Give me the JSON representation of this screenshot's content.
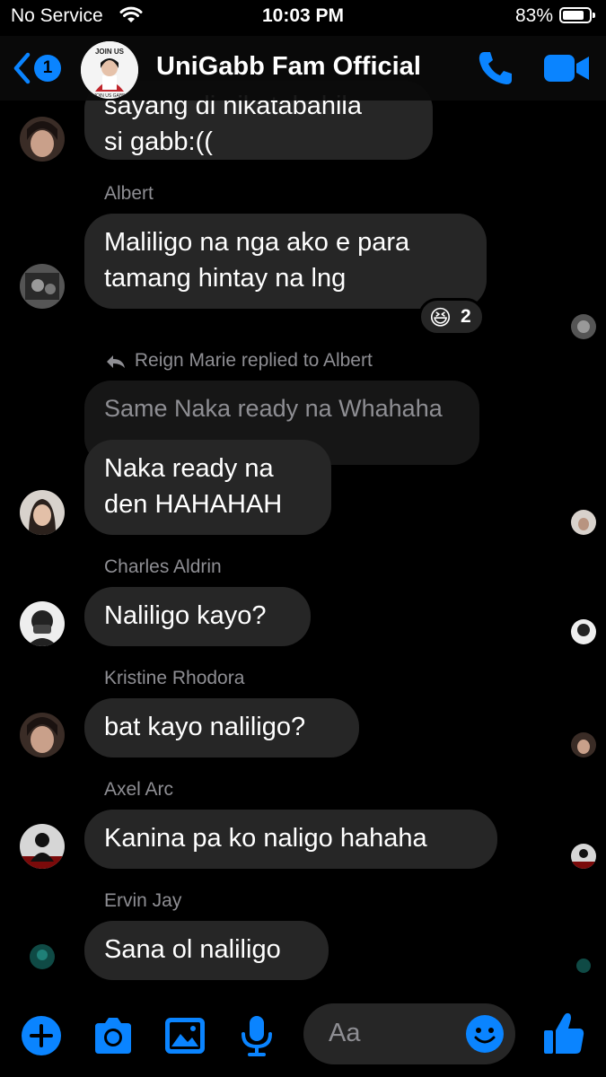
{
  "status_bar": {
    "carrier": "No Service",
    "time": "10:03 PM",
    "battery": "83%",
    "battery_level": 0.83
  },
  "header": {
    "back_count": "1",
    "title": "UniGabb Fam Official",
    "group_avatar_text": "JOIN US",
    "group_avatar_sub": "JOIN US GABB"
  },
  "messages": [
    {
      "id": "m1",
      "sender": "",
      "text": "sayang di nikatabahila\nsi gabb:(("
    },
    {
      "id": "m2",
      "sender": "Albert",
      "text": "Maliligo na nga ako e para\ntamang hintay na lng",
      "reaction": {
        "emoji": "😆",
        "count": "2"
      }
    },
    {
      "id": "m3",
      "sender": "",
      "reply_label": "Reign Marie replied to Albert",
      "quoted": "Same Naka ready na Whahaha",
      "text": "Naka ready na\nden HAHAHAH"
    },
    {
      "id": "m4",
      "sender": "Charles Aldrin",
      "text": "Naliligo kayo?"
    },
    {
      "id": "m5",
      "sender": "Kristine Rhodora",
      "text": "bat kayo naliligo?"
    },
    {
      "id": "m6",
      "sender": "Axel Arc",
      "text": "Kanina pa ko naligo hahaha"
    },
    {
      "id": "m7",
      "sender": "Ervin Jay",
      "text": "Sana ol naliligo"
    }
  ],
  "composer": {
    "placeholder": "Aa"
  },
  "colors": {
    "accent": "#0a84ff",
    "bubble": "#262626",
    "muted": "#8e8e93",
    "background": "#000000"
  }
}
